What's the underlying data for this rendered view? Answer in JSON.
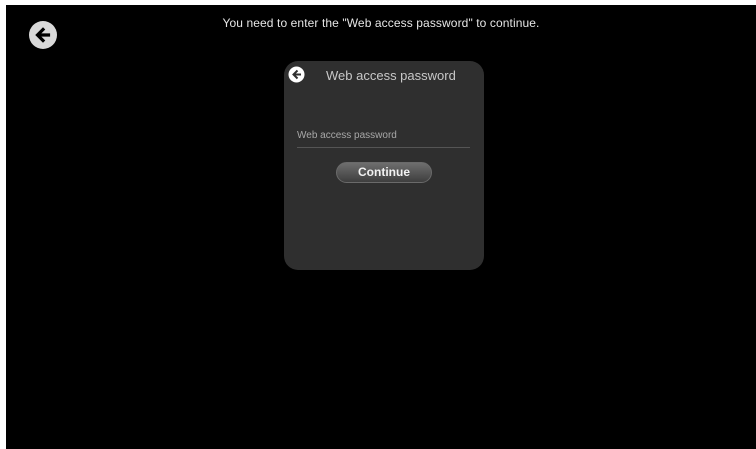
{
  "header": {
    "back_icon": "arrow-left-circle-icon",
    "message": "You need to enter the \"Web access password\" to continue."
  },
  "dialog": {
    "back_icon": "arrow-left-circle-icon",
    "title": "Web access password",
    "password_field": {
      "value": "",
      "placeholder": "Web access password"
    },
    "continue_label": "Continue"
  },
  "colors": {
    "background": "#000000",
    "dialog_background": "#2f2f2f",
    "text": "#e6e6e6"
  }
}
